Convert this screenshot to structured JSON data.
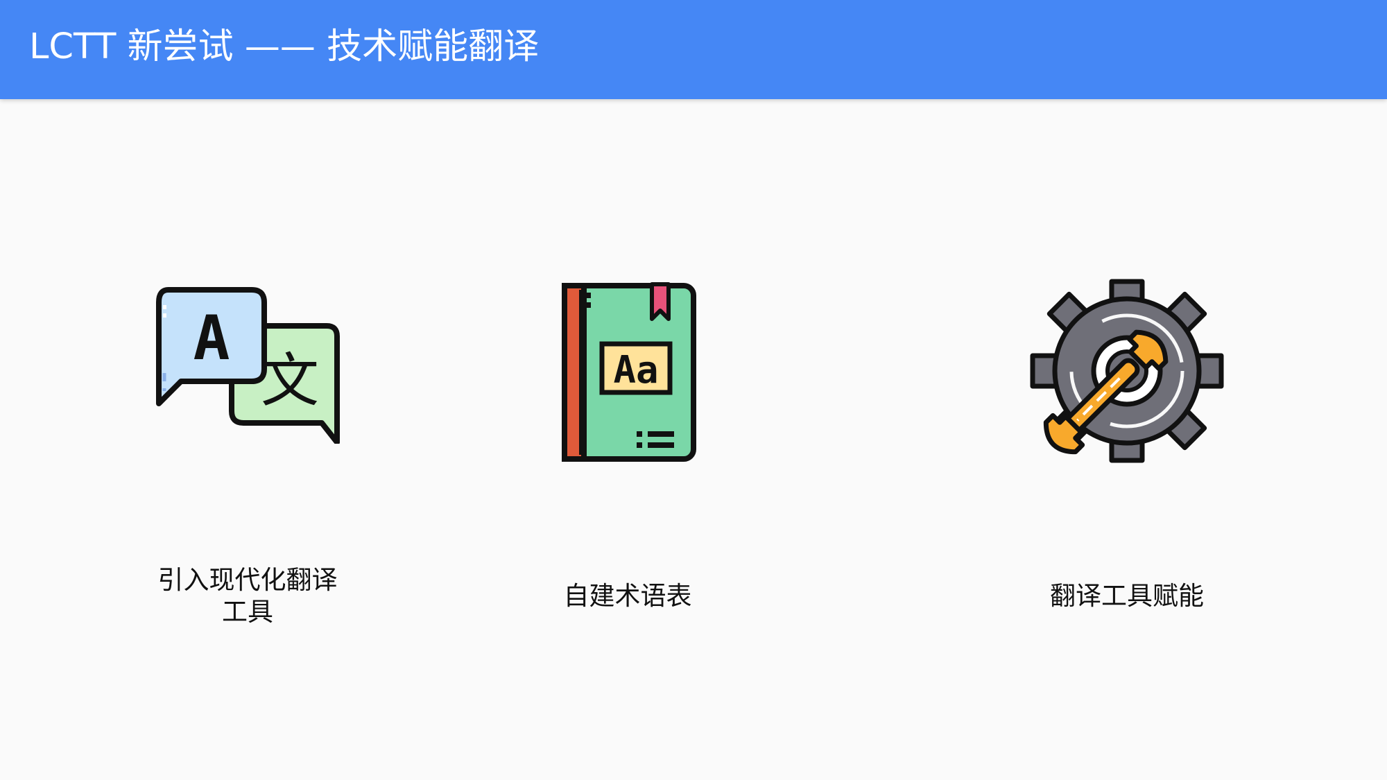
{
  "header": {
    "title": "LCTT 新尝试 —— 技术赋能翻译",
    "background_color": "#4587f5"
  },
  "cards": [
    {
      "icon": "translate-chat-bubbles-icon",
      "label_line1": "引入现代化翻译",
      "label_line2": "工具",
      "icon_text_a": "A",
      "icon_text_b": "文"
    },
    {
      "icon": "glossary-book-icon",
      "label": "自建术语表",
      "icon_text": "Aa"
    },
    {
      "icon": "gear-wrench-icon",
      "label": "翻译工具赋能"
    }
  ],
  "colors": {
    "bubble_blue": "#c5e2fb",
    "bubble_green": "#c8f0c4",
    "book_green": "#7ad7a8",
    "book_spine": "#e05a3a",
    "gear_gray": "#6f6f78",
    "wrench_orange": "#f8a92c"
  }
}
